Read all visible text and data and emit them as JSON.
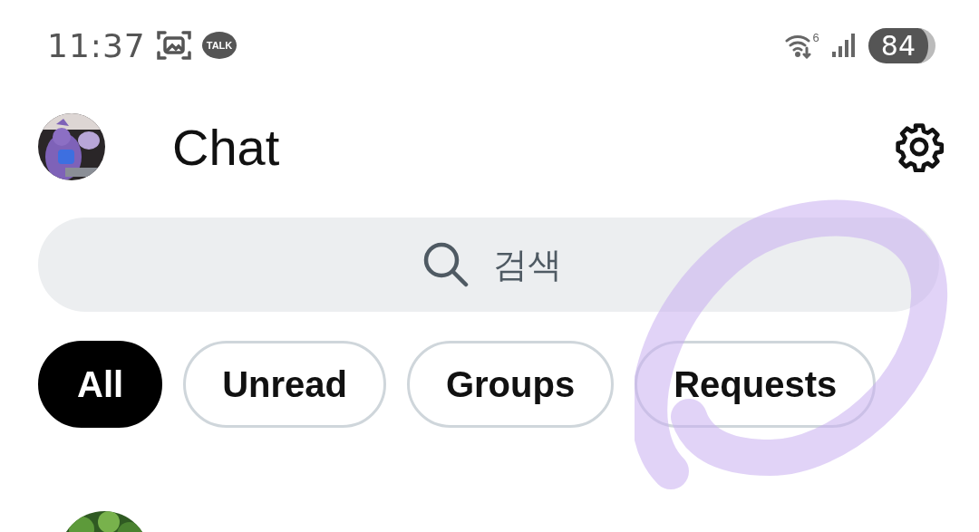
{
  "status_bar": {
    "time": "11:37",
    "talk_badge": "TALK",
    "wifi_label": "6",
    "battery": "84"
  },
  "header": {
    "title": "Chat"
  },
  "search": {
    "placeholder": "검색"
  },
  "filters": [
    {
      "label": "All",
      "selected": true
    },
    {
      "label": "Unread",
      "selected": false
    },
    {
      "label": "Groups",
      "selected": false
    },
    {
      "label": "Requests",
      "selected": false
    }
  ]
}
